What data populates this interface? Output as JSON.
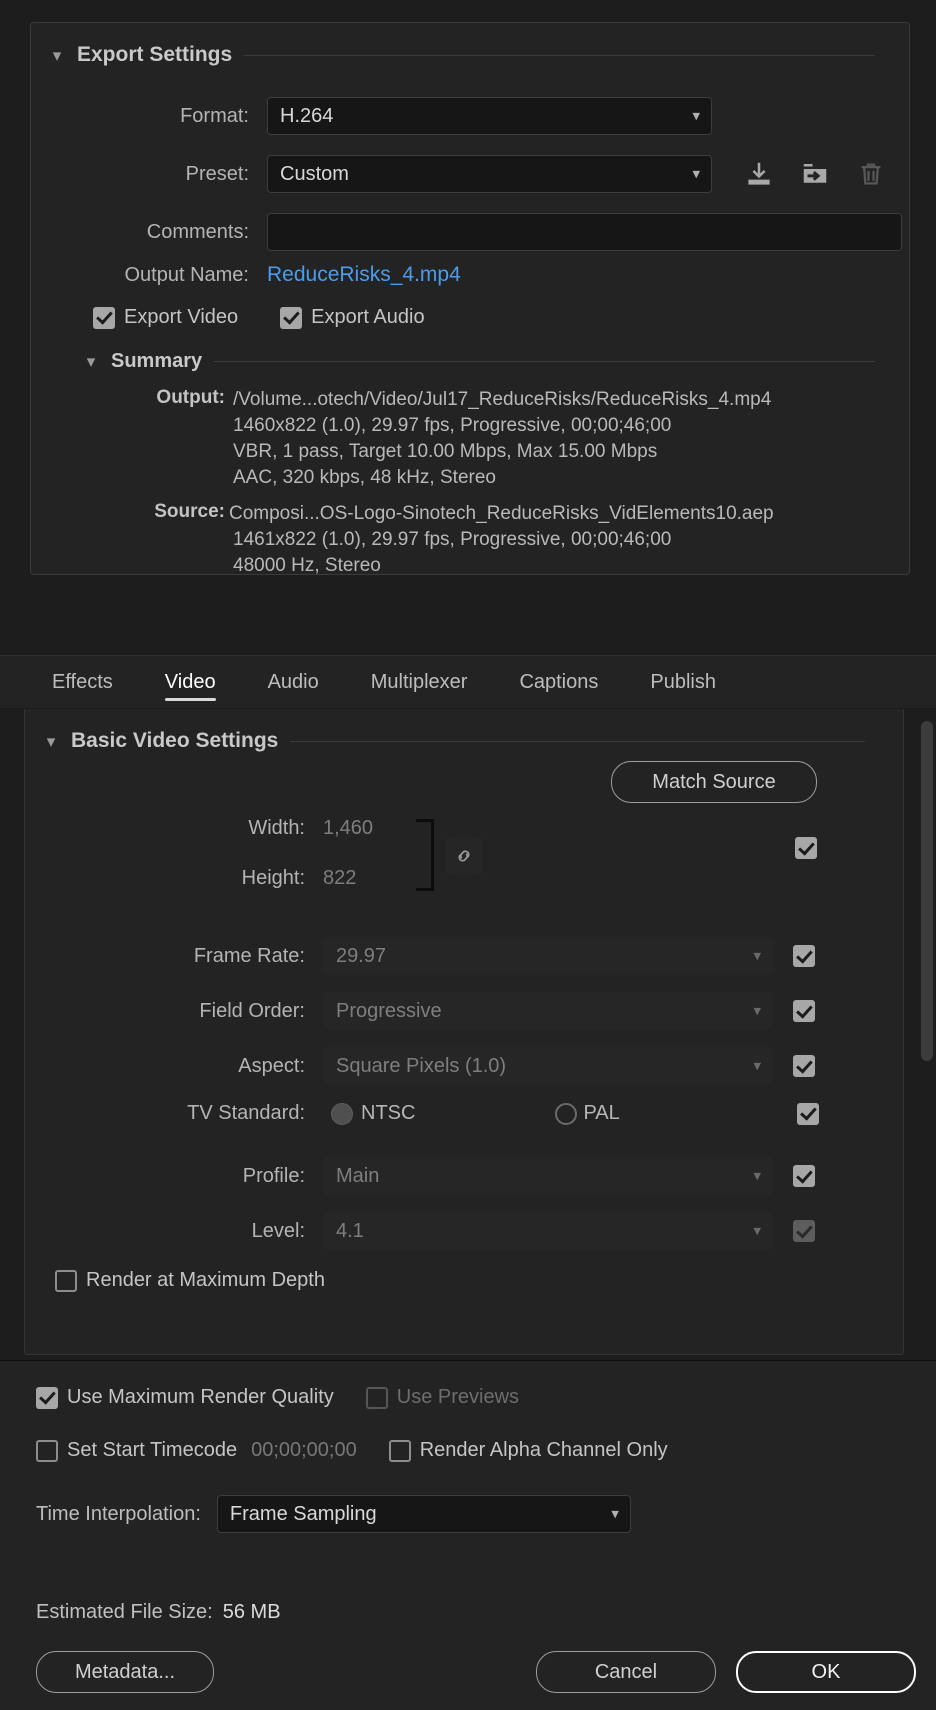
{
  "export_settings": {
    "section_title": "Export Settings",
    "format": {
      "label": "Format:",
      "value": "H.264"
    },
    "preset": {
      "label": "Preset:",
      "value": "Custom"
    },
    "preset_actions": {
      "save_preset": "save-preset-icon",
      "import_preset": "import-preset-icon",
      "delete_preset": "delete-preset-icon"
    },
    "comments": {
      "label": "Comments:",
      "value": "",
      "placeholder": ""
    },
    "output_name": {
      "label": "Output Name:",
      "value": "ReduceRisks_4.mp4",
      "color": "#4a9ced"
    },
    "export_video": {
      "label": "Export Video",
      "checked": true
    },
    "export_audio": {
      "label": "Export Audio",
      "checked": true
    },
    "summary": {
      "section_title": "Summary",
      "output_label": "Output:",
      "output_lines": [
        "/Volume...otech/Video/Jul17_ReduceRisks/ReduceRisks_4.mp4",
        "1460x822 (1.0), 29.97 fps, Progressive, 00;00;46;00",
        "VBR, 1 pass, Target 10.00 Mbps, Max 15.00 Mbps",
        "AAC, 320 kbps, 48 kHz, Stereo"
      ],
      "source_label": "Source:",
      "source_lines": [
        "Composi...OS-Logo-Sinotech_ReduceRisks_VidElements10.aep",
        "1461x822 (1.0), 29.97 fps, Progressive, 00;00;46;00",
        "48000 Hz, Stereo"
      ]
    }
  },
  "tabs": [
    {
      "label": "Effects",
      "active": false
    },
    {
      "label": "Video",
      "active": true
    },
    {
      "label": "Audio",
      "active": false
    },
    {
      "label": "Multiplexer",
      "active": false
    },
    {
      "label": "Captions",
      "active": false
    },
    {
      "label": "Publish",
      "active": false
    }
  ],
  "basic_video_settings": {
    "section_title": "Basic Video Settings",
    "match_source_label": "Match Source",
    "width": {
      "label": "Width:",
      "value": "1,460"
    },
    "height": {
      "label": "Height:",
      "value": "822"
    },
    "link_icon": "link-chain-icon",
    "frame_rate": {
      "label": "Frame Rate:",
      "value": "29.97",
      "checked": true
    },
    "field_order": {
      "label": "Field Order:",
      "value": "Progressive",
      "checked": true
    },
    "aspect": {
      "label": "Aspect:",
      "value": "Square Pixels (1.0)",
      "checked": true
    },
    "tv_standard": {
      "label": "TV Standard:",
      "options": [
        {
          "label": "NTSC",
          "selected": true
        },
        {
          "label": "PAL",
          "selected": false
        }
      ],
      "checked": true
    },
    "profile": {
      "label": "Profile:",
      "value": "Main",
      "checked": true
    },
    "level": {
      "label": "Level:",
      "value": "4.1",
      "checked": true,
      "disabled": true
    },
    "render_max_depth": {
      "label": "Render at Maximum Depth",
      "checked": false
    }
  },
  "footer": {
    "use_max_render_quality": {
      "label": "Use Maximum Render Quality",
      "checked": true
    },
    "use_previews": {
      "label": "Use Previews",
      "checked": false,
      "disabled": true
    },
    "set_start_timecode": {
      "label": "Set Start Timecode",
      "checked": false
    },
    "start_timecode_value": "00;00;00;00",
    "render_alpha_channel_only": {
      "label": "Render Alpha Channel Only",
      "checked": false
    },
    "time_interpolation": {
      "label": "Time Interpolation:",
      "value": "Frame Sampling"
    },
    "estimated_file_size_label": "Estimated File Size:",
    "estimated_file_size_value": "56 MB",
    "metadata_button": "Metadata...",
    "cancel_button": "Cancel",
    "ok_button": "OK"
  }
}
